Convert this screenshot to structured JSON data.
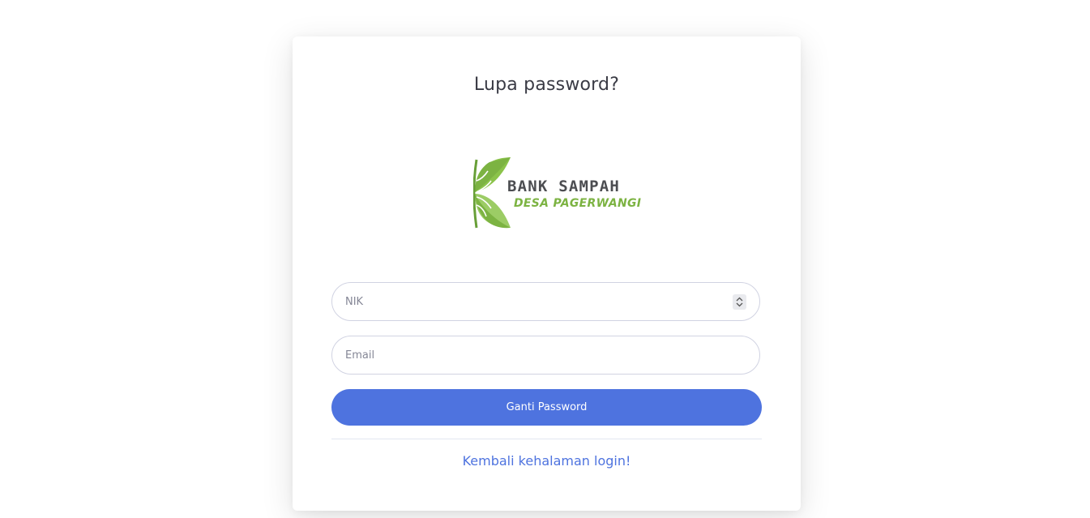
{
  "page": {
    "title": "Lupa password?"
  },
  "logo": {
    "line1": "BANK SAMPAH",
    "line2": "DESA PAGERWANGI",
    "icon": "leaf-icon"
  },
  "form": {
    "nik": {
      "placeholder": "NIK",
      "value": ""
    },
    "email": {
      "placeholder": "Email",
      "value": ""
    },
    "submit_label": "Ganti Password"
  },
  "footer": {
    "back_link": "Kembali kehalaman login!"
  },
  "colors": {
    "primary": "#4e73df",
    "logo_green": "#7cb342",
    "logo_gray": "#4c4d51",
    "title_text": "#3a3b45",
    "input_border": "#d1d3e2"
  }
}
